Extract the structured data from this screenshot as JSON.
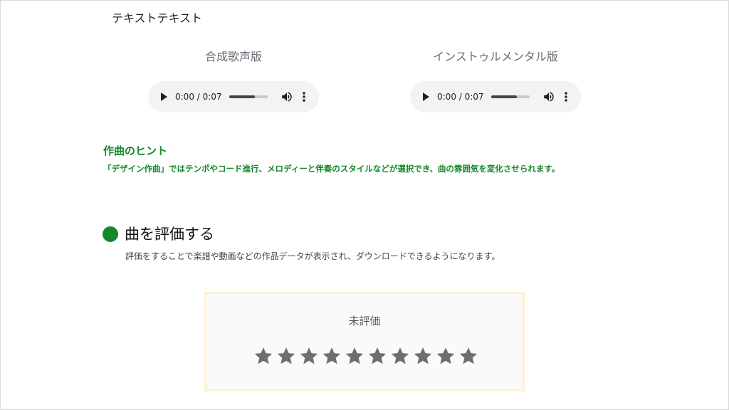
{
  "top_text": "テキストテキスト",
  "players": [
    {
      "title": "合成歌声版",
      "time": "0:00 / 0:07",
      "progress": 0.67
    },
    {
      "title": "インストゥルメンタル版",
      "time": "0:00 / 0:07",
      "progress": 0.67
    }
  ],
  "icons": {
    "play": "play-icon",
    "volume": "volume-icon",
    "more": "more-vertical-icon",
    "bullet": "green-dot-icon",
    "star": "star-icon"
  },
  "hint": {
    "title": "作曲のヒント",
    "text": "「デザイン作曲」ではテンポやコード進行、メロディーと伴奏のスタイルなどが選択でき、曲の雰囲気を変化させられます。"
  },
  "rating_section": {
    "title": "曲を評価する",
    "description": "評価をすることで楽譜や動画などの作品データが表示され、ダウンロードできるようになります。",
    "status": "未評価",
    "star_count": 10,
    "rating": 0
  },
  "colors": {
    "accent_green": "#15882a",
    "star_gray": "#6e6e6e",
    "box_border": "#fdf1cf",
    "audio_bg": "#f1f3f4"
  }
}
